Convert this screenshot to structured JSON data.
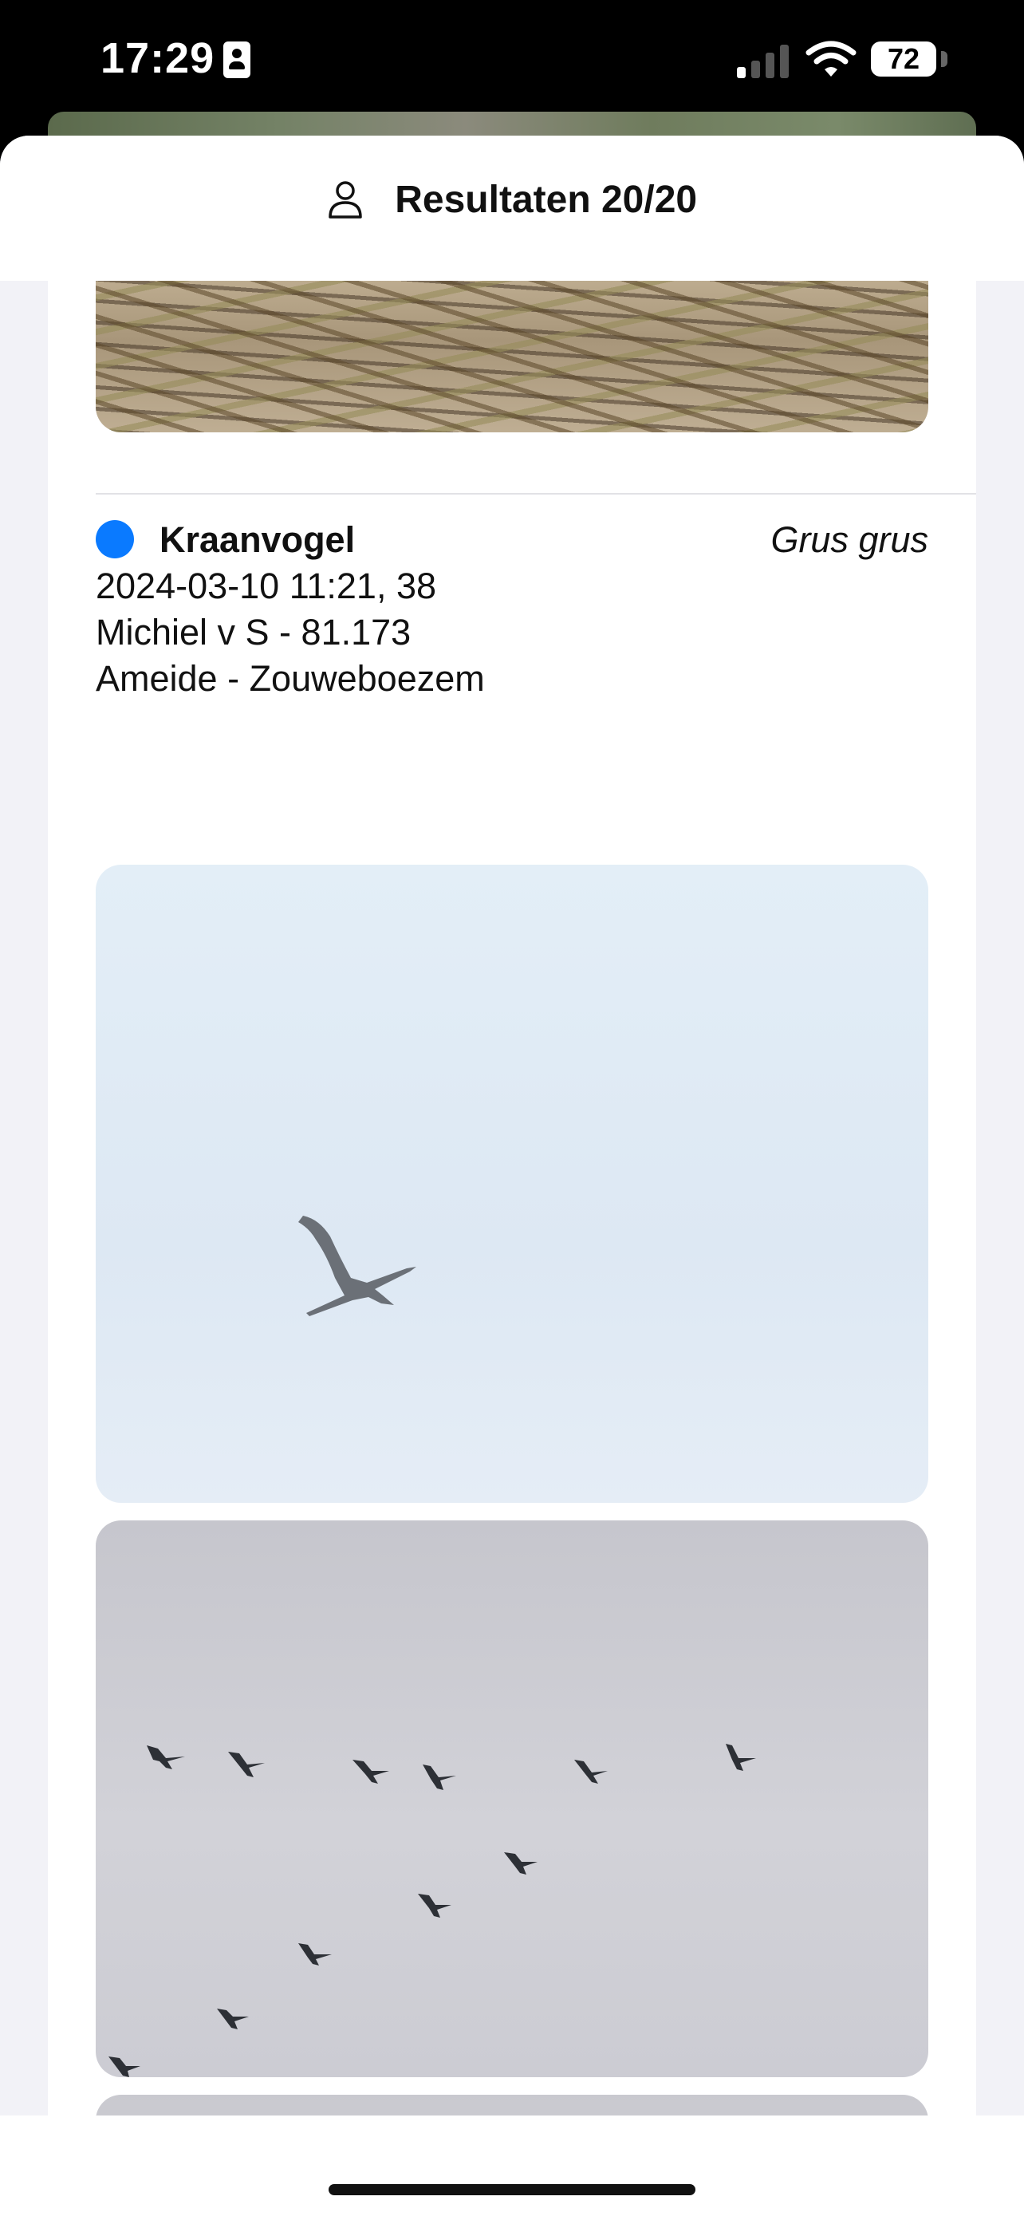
{
  "status_bar": {
    "time": "17:29",
    "battery": "72",
    "icons": [
      "id-card-icon",
      "cellular-signal-icon",
      "wifi-icon",
      "battery-icon"
    ]
  },
  "header": {
    "icon": "person-icon",
    "title": "Resultaten 20/20"
  },
  "observation": {
    "status_color": "#0a7aff",
    "species": "Kraanvogel",
    "scientific_name": "Grus grus",
    "datetime_count": "2024-03-10 11:21, 38",
    "observer": "Michiel v S - 81.173",
    "location": "Ameide - Zouweboezem",
    "photos": [
      "branches-photo",
      "single-crane-photo",
      "crane-flock-photo",
      "grey-sky-photo"
    ]
  },
  "colors": {
    "accent": "#0a7aff",
    "sheet_background": "#f2f2f7",
    "card_background": "#ffffff"
  }
}
